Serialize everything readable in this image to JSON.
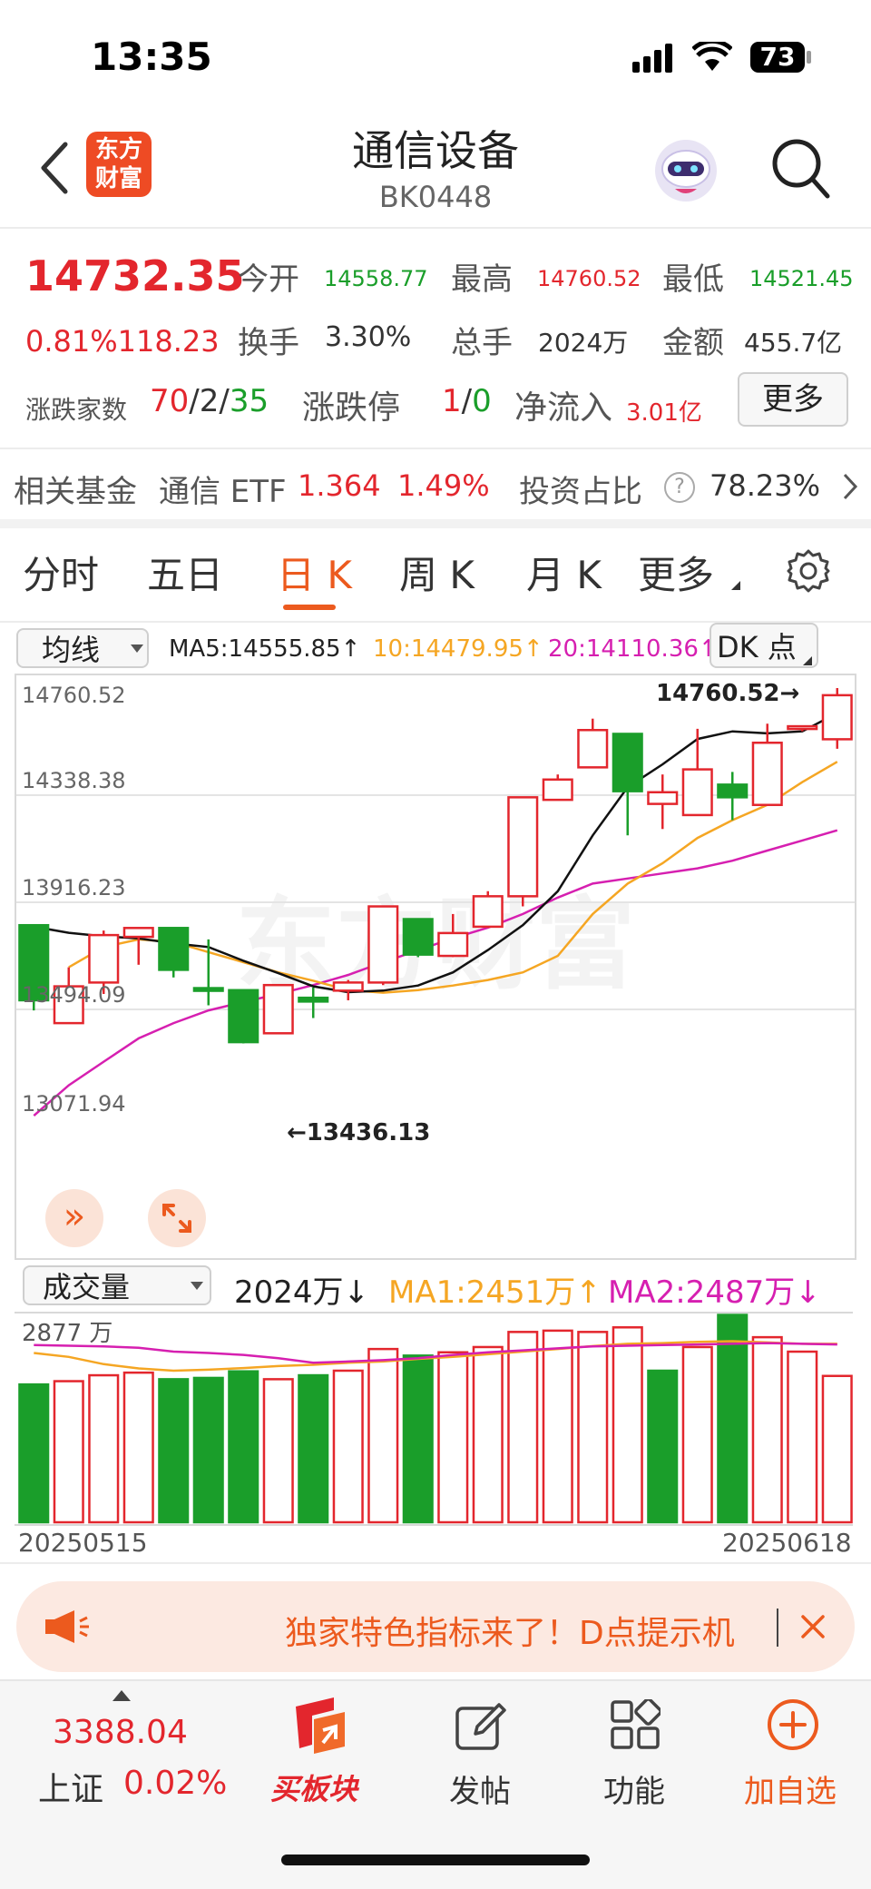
{
  "status_bar": {
    "time": "13:35",
    "battery": "73"
  },
  "header": {
    "title": "通信设备",
    "code": "BK0448",
    "logo_line1": "东方",
    "logo_line2": "财富"
  },
  "quote": {
    "price": "14732.35",
    "change": "0.81%118.23",
    "open_label": "今开",
    "open": "14558.77",
    "high_label": "最高",
    "high": "14760.52",
    "low_label": "最低",
    "low": "14521.45",
    "turnover_label": "换手",
    "turnover": "3.30%",
    "volume_label": "总手",
    "volume": "2024万",
    "amount_label": "金额",
    "amount": "455.7亿",
    "breadth_label": "涨跌家数",
    "breadth_up": "70",
    "breadth_flat": "/2/",
    "breadth_down": "35",
    "limit_label": "涨跌停",
    "limit_up": "1",
    "limit_slash": "/",
    "limit_down": "0",
    "netflow_label": "净流入",
    "netflow": "3.01亿",
    "more_label": "更多"
  },
  "fund": {
    "label": "相关基金",
    "name": "通信 ETF",
    "price": "1.364",
    "pct": "1.49%",
    "ratio_label": "投资占比",
    "ratio": "78.23%"
  },
  "tabs": [
    "分时",
    "五日",
    "日 K",
    "周 K",
    "月 K",
    "更多"
  ],
  "active_tab": "日 K",
  "kline": {
    "ma_select": "均线",
    "ma5": "MA5:14555.85",
    "ma10": "10:14479.95",
    "ma20": "20:14110.36",
    "dk_label": "DK 点",
    "axis_labels": [
      "14760.52",
      "14338.38",
      "13916.23",
      "13494.09",
      "13071.94"
    ],
    "high_marker": "14760.52→",
    "low_marker": "←13436.13",
    "watermark": "东方财富"
  },
  "volume_panel": {
    "select": "成交量",
    "vol": "2024万",
    "ma1": "MA1:2451万",
    "ma2": "MA2:2487万",
    "axis_top": "2877 万",
    "date_start": "20250515",
    "date_end": "20250618"
  },
  "banner": {
    "text": "独家特色指标来了！D点提示机"
  },
  "bottom_nav": {
    "index_value": "3388.04",
    "index_name": "上证",
    "index_pct": "0.02%",
    "items": [
      "买板块",
      "发帖",
      "功能",
      "加自选"
    ]
  },
  "colors": {
    "up": "#e3262d",
    "down": "#1a9e2a",
    "accent": "#ec5a1e",
    "ma10": "#f5a623",
    "ma20": "#d61fb0"
  },
  "chart_data": {
    "type": "candlestick",
    "x_range": [
      "20250515",
      "20250618"
    ],
    "ylim": [
      13071.94,
      14760.52
    ],
    "candles": [
      {
        "o": 13826,
        "h": 13826,
        "l": 13490,
        "c": 13530,
        "up": false
      },
      {
        "o": 13440,
        "h": 13660,
        "l": 13440,
        "c": 13585,
        "up": true
      },
      {
        "o": 13600,
        "h": 13805,
        "l": 13555,
        "c": 13787,
        "up": true
      },
      {
        "o": 13780,
        "h": 13815,
        "l": 13670,
        "c": 13815,
        "up": true
      },
      {
        "o": 13815,
        "h": 13815,
        "l": 13620,
        "c": 13650,
        "up": false
      },
      {
        "o": 13578,
        "h": 13770,
        "l": 13510,
        "c": 13578,
        "up": false
      },
      {
        "o": 13570,
        "h": 13570,
        "l": 13360,
        "c": 13365,
        "up": false
      },
      {
        "o": 13400,
        "h": 13590,
        "l": 13436,
        "c": 13590,
        "up": true
      },
      {
        "o": 13540,
        "h": 13580,
        "l": 13460,
        "c": 13525,
        "up": false
      },
      {
        "o": 13568,
        "h": 13610,
        "l": 13530,
        "c": 13600,
        "up": true
      },
      {
        "o": 13600,
        "h": 13900,
        "l": 13590,
        "c": 13900,
        "up": true
      },
      {
        "o": 13850,
        "h": 13850,
        "l": 13700,
        "c": 13710,
        "up": false
      },
      {
        "o": 13705,
        "h": 13870,
        "l": 13700,
        "c": 13795,
        "up": true
      },
      {
        "o": 13820,
        "h": 13960,
        "l": 13820,
        "c": 13940,
        "up": true
      },
      {
        "o": 13940,
        "h": 14330,
        "l": 13900,
        "c": 14330,
        "up": true
      },
      {
        "o": 14320,
        "h": 14420,
        "l": 14320,
        "c": 14400,
        "up": true
      },
      {
        "o": 14448,
        "h": 14640,
        "l": 14445,
        "c": 14595,
        "up": true
      },
      {
        "o": 14580,
        "h": 14580,
        "l": 14180,
        "c": 14354,
        "up": false
      },
      {
        "o": 14304,
        "h": 14420,
        "l": 14205,
        "c": 14350,
        "up": true
      },
      {
        "o": 14260,
        "h": 14600,
        "l": 14260,
        "c": 14440,
        "up": true
      },
      {
        "o": 14380,
        "h": 14430,
        "l": 14240,
        "c": 14330,
        "up": false
      },
      {
        "o": 14300,
        "h": 14620,
        "l": 14300,
        "c": 14545,
        "up": true
      },
      {
        "o": 14605,
        "h": 14605,
        "l": 14590,
        "c": 14610,
        "up": true
      },
      {
        "o": 14558.77,
        "h": 14760.52,
        "l": 14521.45,
        "c": 14732.35,
        "up": true
      }
    ],
    "ma5": [
      13820,
      13796,
      13782,
      13774,
      13754,
      13740,
      13686,
      13637,
      13585,
      13562,
      13568,
      13588,
      13640,
      13728,
      13826,
      13960,
      14180,
      14370,
      14460,
      14560,
      14590,
      14582,
      14590,
      14662
    ],
    "ma10": [
      null,
      13660,
      13740,
      13770,
      13760,
      13720,
      13680,
      13640,
      13607,
      13570,
      13560,
      13570,
      13588,
      13610,
      13640,
      13705,
      13870,
      13990,
      14070,
      14170,
      14240,
      14300,
      14390,
      14470
    ],
    "ma20": [
      13075,
      13195,
      13288,
      13380,
      13440,
      13490,
      13523,
      13555,
      13590,
      13630,
      13680,
      13727,
      13775,
      13816,
      13870,
      13935,
      13990,
      14010,
      14030,
      14050,
      14080,
      14120,
      14160,
      14200
    ],
    "volume": {
      "ylim": [
        0,
        2877
      ],
      "values": [
        2100,
        2150,
        2240,
        2280,
        2180,
        2200,
        2300,
        2180,
        2240,
        2310,
        2640,
        2540,
        2590,
        2670,
        2900,
        2920,
        2900,
        2970,
        2310,
        2670,
        3160,
        2820,
        2600,
        2230
      ],
      "up": [
        false,
        true,
        true,
        true,
        false,
        false,
        false,
        true,
        false,
        true,
        true,
        false,
        true,
        true,
        true,
        true,
        true,
        true,
        false,
        true,
        false,
        true,
        true,
        true
      ],
      "ma1": [
        2580,
        2520,
        2410,
        2345,
        2310,
        2325,
        2350,
        2380,
        2400,
        2430,
        2450,
        2490,
        2520,
        2560,
        2600,
        2640,
        2685,
        2720,
        2730,
        2750,
        2760,
        2740,
        2720,
        2720
      ],
      "ma2": [
        2700,
        2690,
        2680,
        2660,
        2600,
        2580,
        2550,
        2500,
        2430,
        2450,
        2470,
        2500,
        2550,
        2590,
        2620,
        2650,
        2680,
        2690,
        2700,
        2710,
        2720,
        2730,
        2720,
        2710
      ]
    }
  }
}
